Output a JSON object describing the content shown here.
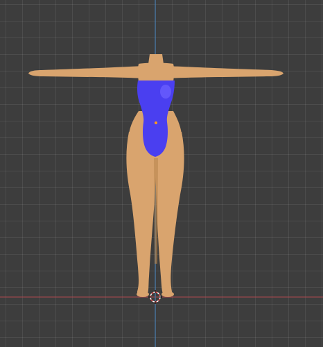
{
  "viewport": {
    "background": "#3d3d3d",
    "grid_color": "#4a4a4a",
    "x_axis_color": "#b0494f",
    "z_axis_color": "#3f7fbd"
  },
  "model": {
    "skin_color": "#d9a46e",
    "skin_shade": "#b9874f",
    "suit_color": "#4a3ff0",
    "suit_highlight": "#6d63ff",
    "origin_color": "#ff9c1a"
  },
  "cursor": {
    "icon": "3d-cursor-icon",
    "ring_color": "#ffffff",
    "ring_alt_color": "#e04040"
  }
}
